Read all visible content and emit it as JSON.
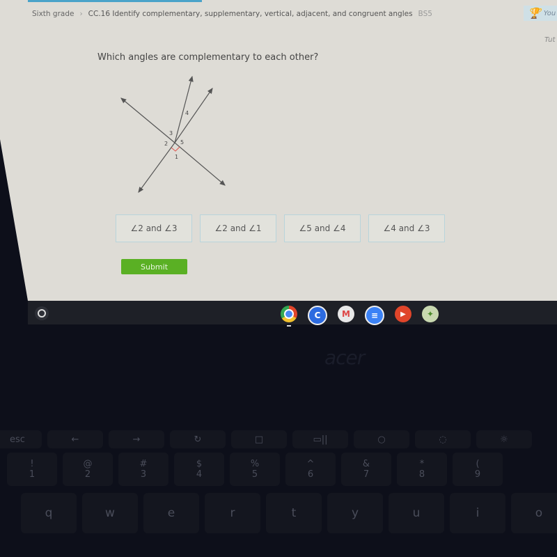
{
  "breadcrumb": {
    "grade": "Sixth grade",
    "separator": "›",
    "skill": "CC.16 Identify complementary, supplementary, vertical, adjacent, and congruent angles",
    "code": "BS5"
  },
  "award": {
    "label": "You"
  },
  "tutorial": {
    "label": "Tut"
  },
  "question": "Which angles are complementary to each other?",
  "diagram": {
    "angle_labels": [
      "1",
      "2",
      "3",
      "4",
      "5"
    ],
    "right_angle_marker_color": "#e0524a"
  },
  "choices": [
    {
      "label": "∠2 and ∠3"
    },
    {
      "label": "∠2 and ∠1"
    },
    {
      "label": "∠5 and ∠4"
    },
    {
      "label": "∠4 and ∠3"
    }
  ],
  "submit_label": "Submit",
  "shelf": {
    "apps": [
      {
        "name": "chrome",
        "glyph": "",
        "color": "#e8a82a"
      },
      {
        "name": "classroom-c",
        "glyph": "C",
        "color": "#2d6be0"
      },
      {
        "name": "gmail",
        "glyph": "M",
        "color": "#e0e0e0"
      },
      {
        "name": "docs",
        "glyph": "≡",
        "color": "#3b82f6"
      },
      {
        "name": "youtube",
        "glyph": "▶",
        "color": "#e0452a"
      },
      {
        "name": "app-green",
        "glyph": "✦",
        "color": "#c8d8b0"
      }
    ]
  },
  "laptop": {
    "brand": "acer",
    "fn_row": [
      "esc",
      "←",
      "→",
      "↻",
      "□",
      "▭||",
      "○",
      "◌",
      "☼"
    ],
    "number_row": [
      [
        "!",
        "1"
      ],
      [
        "@",
        "2"
      ],
      [
        "#",
        "3"
      ],
      [
        "$",
        "4"
      ],
      [
        "%",
        "5"
      ],
      [
        "^",
        "6"
      ],
      [
        "&",
        "7"
      ],
      [
        "*",
        "8"
      ],
      [
        "(",
        "9"
      ]
    ],
    "letter_row": [
      "q",
      "w",
      "e",
      "r",
      "t",
      "y",
      "u",
      "i",
      "o"
    ]
  }
}
